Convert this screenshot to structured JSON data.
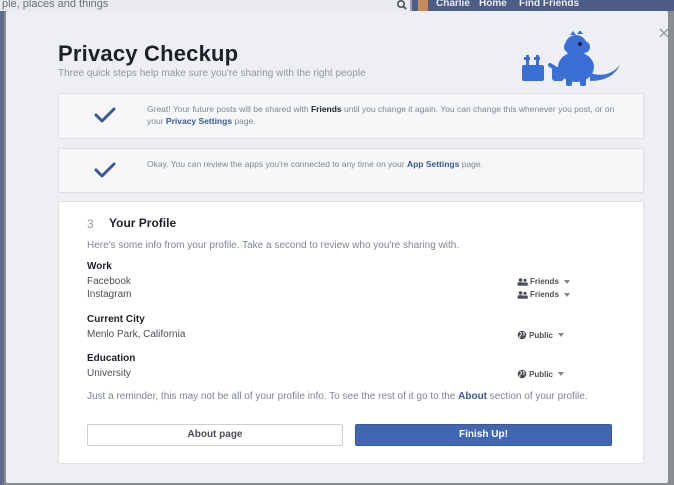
{
  "topbar": {
    "search_placeholder": "ple, places and things",
    "user_name": "Charlie",
    "home_label": "Home",
    "find_friends_label": "Find Friends"
  },
  "modal": {
    "title": "Privacy Checkup",
    "subtitle": "Three quick steps help make sure you're sharing with the right people",
    "step1": {
      "text_a": "Great! Your future posts will be shared with ",
      "bold": "Friends",
      "text_b": " until you change it again. You can change this whenever you post, or on your ",
      "link": "Privacy Settings",
      "text_c": " page."
    },
    "step2": {
      "text_a": "Okay. You can review the apps you're connected to any time on your ",
      "link": "App Settings",
      "text_b": " page."
    },
    "profile": {
      "number": "3",
      "title": "Your Profile",
      "intro": "Here's some info from your profile. Take a second to review who you're sharing with.",
      "sections": [
        {
          "heading": "Work",
          "rows": [
            {
              "label": "Facebook",
              "audience": "Friends"
            },
            {
              "label": "Instagram",
              "audience": "Friends"
            }
          ]
        },
        {
          "heading": "Current City",
          "rows": [
            {
              "label": "Menlo Park, California",
              "audience": "Public"
            }
          ]
        },
        {
          "heading": "Education",
          "rows": [
            {
              "label": "University",
              "audience": "Public"
            }
          ]
        }
      ],
      "reminder_a": "Just a reminder, this may not be all of your profile info. To see the rest of it go to the ",
      "reminder_link": "About",
      "reminder_b": " section of your profile.",
      "about_button": "About page",
      "finish_button": "Finish Up!"
    }
  },
  "colors": {
    "accent": "#4267b2",
    "link": "#3b5998",
    "mascot": "#3b6fd8"
  },
  "icons": [
    "search-icon",
    "close-icon",
    "check-icon",
    "friends-icon",
    "globe-icon",
    "caret-down-icon"
  ]
}
